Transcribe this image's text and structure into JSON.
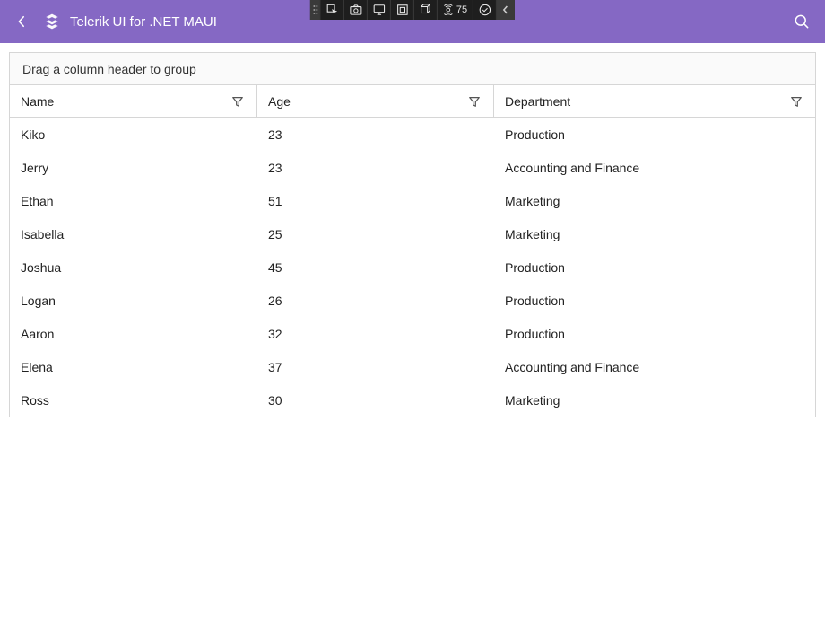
{
  "header": {
    "title": "Telerik UI for .NET MAUI"
  },
  "debug_toolbar": {
    "fps_label": "75"
  },
  "grid": {
    "group_panel_hint": "Drag a column header to group",
    "columns": [
      {
        "key": "name",
        "label": "Name"
      },
      {
        "key": "age",
        "label": "Age"
      },
      {
        "key": "dept",
        "label": "Department"
      }
    ],
    "rows": [
      {
        "name": "Kiko",
        "age": "23",
        "dept": "Production"
      },
      {
        "name": "Jerry",
        "age": "23",
        "dept": "Accounting and Finance"
      },
      {
        "name": "Ethan",
        "age": "51",
        "dept": "Marketing"
      },
      {
        "name": "Isabella",
        "age": "25",
        "dept": "Marketing"
      },
      {
        "name": "Joshua",
        "age": "45",
        "dept": "Production"
      },
      {
        "name": "Logan",
        "age": "26",
        "dept": "Production"
      },
      {
        "name": "Aaron",
        "age": "32",
        "dept": "Production"
      },
      {
        "name": "Elena",
        "age": "37",
        "dept": "Accounting and Finance"
      },
      {
        "name": "Ross",
        "age": "30",
        "dept": "Marketing"
      }
    ]
  }
}
